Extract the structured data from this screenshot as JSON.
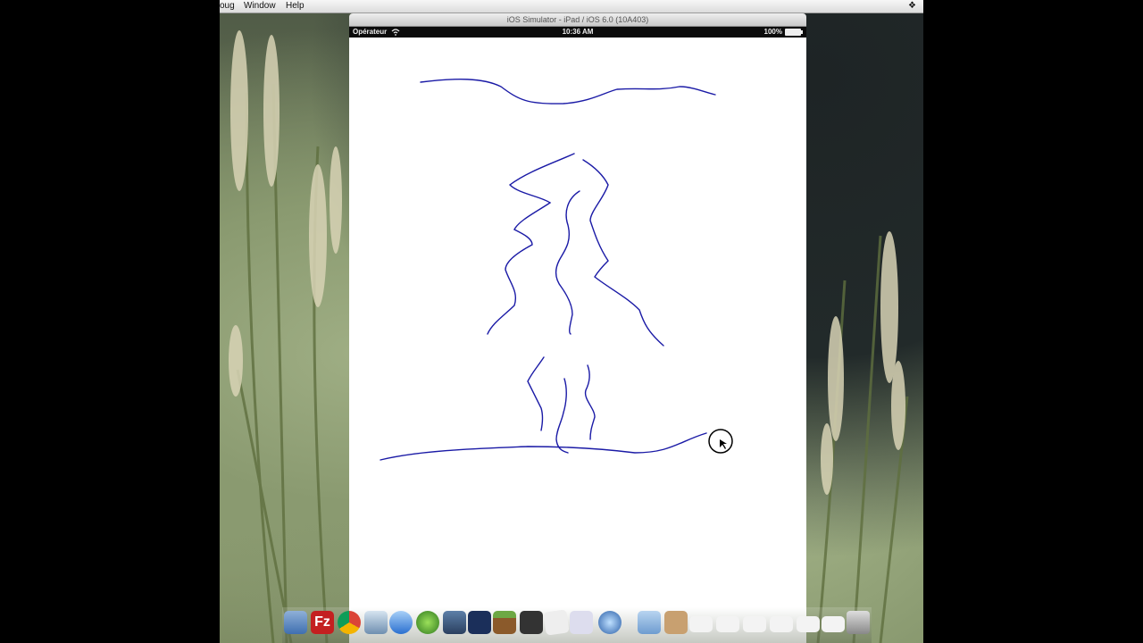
{
  "menubar": {
    "items": [
      "oug",
      "Window",
      "Help"
    ],
    "right_icon": "dropbox-icon"
  },
  "simulator": {
    "title": "iOS Simulator - iPad / iOS 6.0 (10A403)",
    "status_bar": {
      "carrier": "Opérateur",
      "time": "10:36 AM",
      "battery": "100%",
      "wifi_icon": "wifi-icon"
    },
    "drawing": {
      "stroke_color": "#1a1aa6",
      "cursor": "touch-pointer-icon"
    }
  },
  "dock": {
    "items": [
      "finder",
      "filezilla",
      "chrome",
      "preview",
      "ichat",
      "game",
      "xcode",
      "ibooks",
      "minecraft",
      "terminal",
      "textedit",
      "notes",
      "quicktime",
      "folder",
      "archive",
      "window-1",
      "window-2",
      "window-3",
      "window-4",
      "window-5",
      "window-6",
      "window-7",
      "trash"
    ]
  }
}
